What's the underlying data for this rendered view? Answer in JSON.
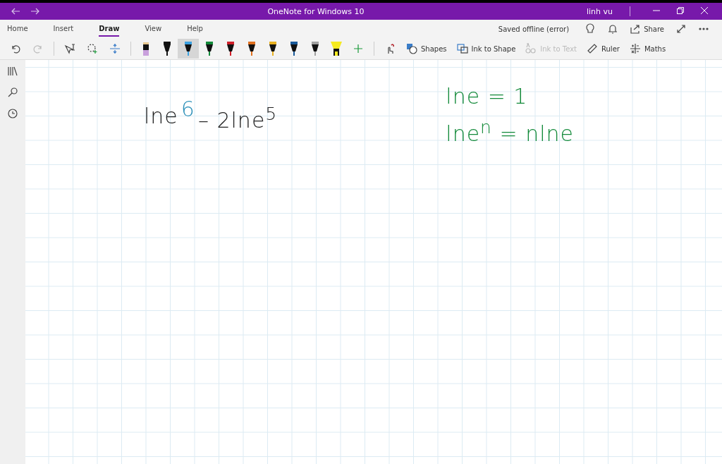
{
  "window": {
    "title": "OneNote for Windows 10",
    "user": "linh vu"
  },
  "tabs": [
    {
      "label": "Home",
      "selected": false
    },
    {
      "label": "Insert",
      "selected": false
    },
    {
      "label": "Draw",
      "selected": true
    },
    {
      "label": "View",
      "selected": false
    },
    {
      "label": "Help",
      "selected": false
    }
  ],
  "status": {
    "text": "Saved offline (error)",
    "share": "Share"
  },
  "pens": [
    {
      "kind": "pencil",
      "color": "#c9a0dc",
      "selected": false
    },
    {
      "kind": "pen",
      "color": "#111111",
      "selected": false
    },
    {
      "kind": "pen",
      "color": "#3aa0e0",
      "selected": true
    },
    {
      "kind": "pen",
      "color": "#138a3a",
      "selected": false
    },
    {
      "kind": "pen",
      "color": "#d0202a",
      "selected": false
    },
    {
      "kind": "pen",
      "color": "#e07020",
      "selected": false
    },
    {
      "kind": "pen",
      "color": "#e8b020",
      "selected": false
    },
    {
      "kind": "pen",
      "color": "#1a5a9a",
      "selected": false
    },
    {
      "kind": "pen",
      "color": "#a0a0a0",
      "selected": false
    },
    {
      "kind": "highlighter",
      "color": "#f5ea20",
      "selected": false
    }
  ],
  "tools": [
    {
      "kind": "shapes",
      "label": "Shapes",
      "disabled": false
    },
    {
      "kind": "ink-to-shape",
      "label": "Ink to Shape",
      "disabled": false
    },
    {
      "kind": "ink-to-text",
      "label": "Ink to Text",
      "disabled": true
    },
    {
      "kind": "ruler",
      "label": "Ruler",
      "disabled": false
    },
    {
      "kind": "maths",
      "label": "Maths",
      "disabled": false
    }
  ],
  "ink_left": [
    {
      "text": "lne",
      "color": "#222222"
    },
    {
      "text": "6",
      "color": "#2a8fb8"
    },
    {
      "text": "– 2lne$^{5}$",
      "color": "#222222"
    }
  ],
  "ink_right": [
    {
      "text": "lne = 1",
      "color": "#138a3a"
    },
    {
      "text": "lne$^{n}$ = nlne",
      "color": "#138a3a"
    }
  ]
}
